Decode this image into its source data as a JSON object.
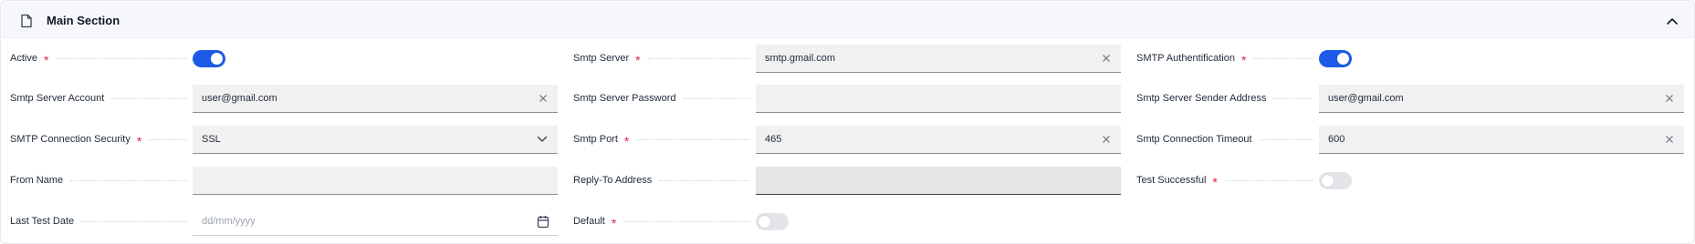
{
  "section": {
    "title": "Main Section"
  },
  "fields": {
    "active": {
      "label": "Active",
      "required": "*",
      "value": true
    },
    "smtp_server": {
      "label": "Smtp Server",
      "required": "*",
      "value": "smtp.gmail.com"
    },
    "smtp_authentification": {
      "label": "SMTP Authentification",
      "required": "*",
      "value": true
    },
    "smtp_server_account": {
      "label": "Smtp Server Account",
      "value": "user@gmail.com"
    },
    "smtp_server_password": {
      "label": "Smtp Server Password",
      "value": ""
    },
    "smtp_server_sender_address": {
      "label": "Smtp Server Sender Address",
      "value": "user@gmail.com"
    },
    "smtp_connection_security": {
      "label": "SMTP Connection Security",
      "required": "*",
      "value": "SSL"
    },
    "smtp_port": {
      "label": "Smtp Port",
      "required": "*",
      "value": "465"
    },
    "smtp_connection_timeout": {
      "label": "Smtp Connection Timeout",
      "value": "600"
    },
    "from_name": {
      "label": "From Name",
      "value": ""
    },
    "reply_to_address": {
      "label": "Reply-To Address",
      "value": ""
    },
    "test_successful": {
      "label": "Test Successful",
      "required": "*",
      "value": false
    },
    "last_test_date": {
      "label": "Last Test Date",
      "placeholder": "dd/mm/yyyy",
      "value": ""
    },
    "default": {
      "label": "Default",
      "required": "*",
      "value": false
    }
  },
  "colors": {
    "toggle_on": "#1e5ae8",
    "toggle_off": "#e2e4e8",
    "required": "#e11d48"
  }
}
